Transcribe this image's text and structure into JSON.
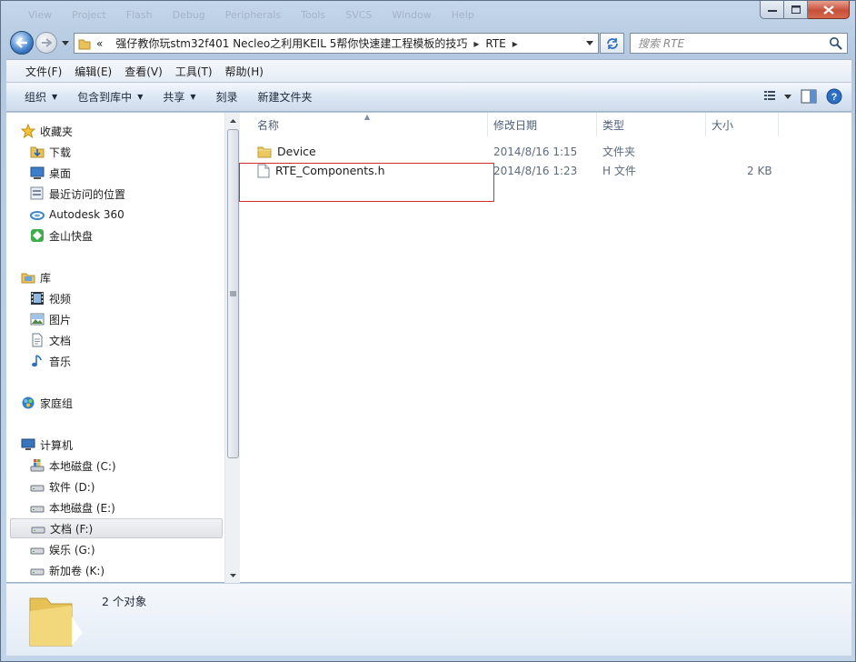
{
  "window": {
    "faint_menu": [
      "View",
      "Project",
      "Flash",
      "Debug",
      "Peripherals",
      "Tools",
      "SVCS",
      "Window",
      "Help"
    ]
  },
  "address": {
    "overflow": "«",
    "crumbs": [
      "强仔教你玩stm32f401 Necleo之利用KEIL 5帮你快速建工程模板的技巧",
      "RTE"
    ],
    "search_placeholder": "搜索 RTE"
  },
  "menu": [
    "文件(F)",
    "编辑(E)",
    "查看(V)",
    "工具(T)",
    "帮助(H)"
  ],
  "commands": {
    "organize": "组织",
    "include_in_library": "包含到库中",
    "share": "共享",
    "burn": "刻录",
    "new_folder": "新建文件夹"
  },
  "navigation": {
    "favorites": {
      "label": "收藏夹",
      "items": [
        "下载",
        "桌面",
        "最近访问的位置",
        "Autodesk 360",
        "金山快盘"
      ]
    },
    "libraries": {
      "label": "库",
      "items": [
        "视频",
        "图片",
        "文档",
        "音乐"
      ]
    },
    "homegroup": "家庭组",
    "computer": {
      "label": "计算机",
      "drives": [
        "本地磁盘 (C:)",
        "软件 (D:)",
        "本地磁盘 (E:)",
        "文档 (F:)",
        "娱乐 (G:)",
        "新加卷 (K:)"
      ],
      "selected": "文档 (F:)"
    }
  },
  "columns": [
    "名称",
    "修改日期",
    "类型",
    "大小"
  ],
  "files": [
    {
      "name": "Device",
      "date": "2014/8/16 1:15",
      "type": "文件夹",
      "size": "",
      "icon": "folder-icon"
    },
    {
      "name": "RTE_Components.h",
      "date": "2014/8/16 1:23",
      "type": "H 文件",
      "size": "2 KB",
      "icon": "file-icon"
    }
  ],
  "status": {
    "count": "2 个对象"
  },
  "colors": {
    "highlight_box": "#d92c2c",
    "accent": "#3f7fc9"
  }
}
